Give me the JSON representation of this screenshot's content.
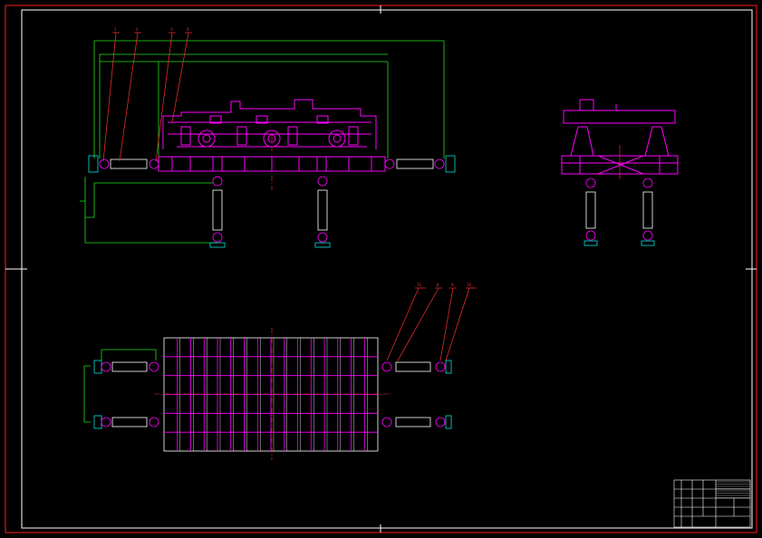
{
  "colors": {
    "background": "#000000",
    "frame": "#ff2020",
    "border": "#ffffff",
    "structure": "#ff00ff",
    "centerline": "#ff3030",
    "dimension": "#20e020",
    "cyan": "#00e0e0",
    "leader": "#ff3030"
  },
  "labels": {
    "front_view": [
      "1",
      "2",
      "3",
      "4"
    ],
    "plan_view": [
      "11",
      "8",
      "9",
      "10"
    ]
  },
  "views": [
    "front-view",
    "side-view",
    "plan-view",
    "title-block"
  ]
}
